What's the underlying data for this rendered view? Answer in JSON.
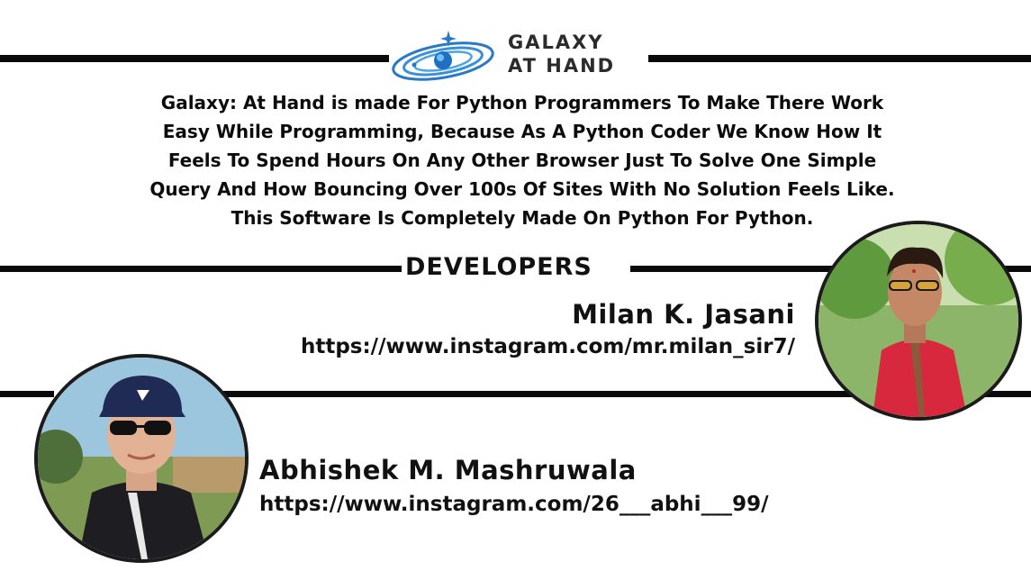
{
  "brand": {
    "line1": "GALAXY",
    "line2": "AT HAND"
  },
  "description": [
    "Galaxy: At Hand is made For Python Programmers To Make There Work",
    "Easy While Programming, Because As A Python Coder We Know How It",
    "Feels To Spend Hours On Any Other Browser Just To Solve One Simple",
    "Query And How Bouncing Over 100s Of Sites With No Solution Feels Like.",
    "This Software Is Completely Made On Python For Python."
  ],
  "developers_heading": "DEVELOPERS",
  "developers": [
    {
      "name": "Milan K. Jasani",
      "link": "https://www.instagram.com/mr.milan_sir7/"
    },
    {
      "name": "Abhishek M. Mashruwala",
      "link": "https://www.instagram.com/26___abhi___99/"
    }
  ],
  "icons": [
    "galaxy-logo-icon",
    "developer-photo-milan",
    "developer-photo-abhishek"
  ]
}
